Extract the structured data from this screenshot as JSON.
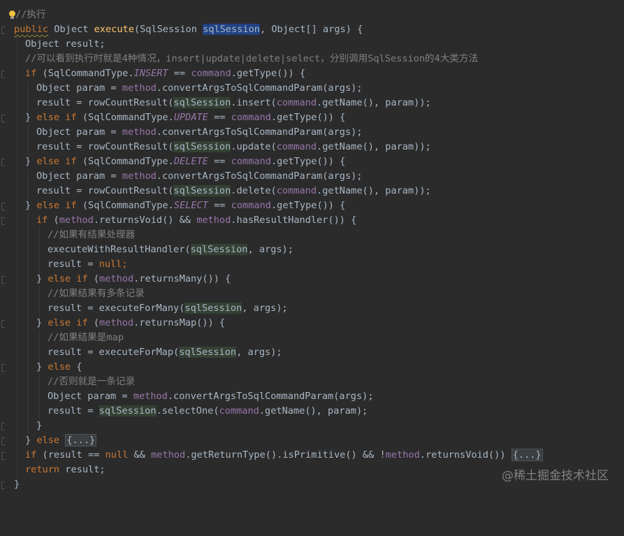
{
  "code": {
    "l0_comment": "//执行",
    "l1_public": "public",
    "l1_type": " Object ",
    "l1_method": "execute",
    "l1_open": "(SqlSession ",
    "l1_param": "sqlSession",
    "l1_rest": ", Object[] args) {",
    "l2": "Object result;",
    "l3_comment": "//可以看到执行时就是4种情况，insert|update|delete|select，分别调用SqlSession的4大类方法",
    "l4_if": "if",
    "l4_a": " (SqlCommandType.",
    "l4_const": "INSERT",
    "l4_b": " == ",
    "l4_cmd": "command",
    "l4_c": ".getType()) {",
    "l5_a": "Object param = ",
    "l5_method": "method",
    "l5_b": ".convertArgsToSqlCommandParam(args);",
    "l6_a": "result = rowCountResult(",
    "l6_sess": "sqlSession",
    "l6_b": ".insert(",
    "l6_cmd": "command",
    "l6_c": ".getName(), param));",
    "l7_a": "} ",
    "l7_kw": "else if",
    "l7_b": " (SqlCommandType.",
    "l7_const": "UPDATE",
    "l7_c": " == ",
    "l7_cmd": "command",
    "l7_d": ".getType()) {",
    "l8_a": "Object param = ",
    "l8_method": "method",
    "l8_b": ".convertArgsToSqlCommandParam(args);",
    "l9_a": "result = rowCountResult(",
    "l9_sess": "sqlSession",
    "l9_b": ".update(",
    "l9_cmd": "command",
    "l9_c": ".getName(), param));",
    "l10_a": "} ",
    "l10_kw": "else if",
    "l10_b": " (SqlCommandType.",
    "l10_const": "DELETE",
    "l10_c": " == ",
    "l10_cmd": "command",
    "l10_d": ".getType()) {",
    "l11_a": "Object param = ",
    "l11_method": "method",
    "l11_b": ".convertArgsToSqlCommandParam(args);",
    "l12_a": "result = rowCountResult(",
    "l12_sess": "sqlSession",
    "l12_b": ".delete(",
    "l12_cmd": "command",
    "l12_c": ".getName(), param));",
    "l13_a": "} ",
    "l13_kw": "else if",
    "l13_b": " (SqlCommandType.",
    "l13_const": "SELECT",
    "l13_c": " == ",
    "l13_cmd": "command",
    "l13_d": ".getType()) {",
    "l14_if": "if",
    "l14_a": " (",
    "l14_m1": "method",
    "l14_b": ".returnsVoid() && ",
    "l14_m2": "method",
    "l14_c": ".hasResultHandler()) {",
    "l15_comment": "//如果有结果处理器",
    "l16_a": "executeWithResultHandler(",
    "l16_sess": "sqlSession",
    "l16_b": ", args);",
    "l17_a": "result = ",
    "l17_null": "null",
    "l17_b": ";",
    "l18_a": "} ",
    "l18_kw": "else if",
    "l18_b": " (",
    "l18_m": "method",
    "l18_c": ".returnsMany()) {",
    "l19_comment": "//如果结果有多条记录",
    "l20_a": "result = executeForMany(",
    "l20_sess": "sqlSession",
    "l20_b": ", args);",
    "l21_a": "} ",
    "l21_kw": "else if",
    "l21_b": " (",
    "l21_m": "method",
    "l21_c": ".returnsMap()) {",
    "l22_comment": "//如果结果是map",
    "l23_a": "result = executeForMap(",
    "l23_sess": "sqlSession",
    "l23_b": ", args);",
    "l24_a": "} ",
    "l24_kw": "else",
    "l24_b": " {",
    "l25_comment": "//否则就是一条记录",
    "l26_a": "Object param = ",
    "l26_method": "method",
    "l26_b": ".convertArgsToSqlCommandParam(args);",
    "l27_a": "result = ",
    "l27_sess": "sqlSession",
    "l27_b": ".selectOne(",
    "l27_cmd": "command",
    "l27_c": ".getName(), param);",
    "l28": "}",
    "l29_a": "} ",
    "l29_kw": "else",
    "l29_b": " ",
    "l29_fold": "{...}",
    "l30_if": "if",
    "l30_a": " (result == ",
    "l30_null": "null",
    "l30_b": " && ",
    "l30_m1": "method",
    "l30_c": ".getReturnType().isPrimitive() && !",
    "l30_m2": "method",
    "l30_d": ".returnsVoid()) ",
    "l30_fold": "{...}",
    "l31_kw": "return",
    "l31_b": " result;",
    "l32": "}"
  },
  "watermark": "@稀土掘金技术社区",
  "colors": {
    "background": "#2b2b2b",
    "keyword": "#cc7832",
    "comment": "#808080",
    "method_decl": "#ffc66d",
    "field": "#9876aa",
    "default_text": "#a9b7c6",
    "selection": "#214283",
    "read_highlight": "#344134"
  },
  "icons": [
    "lightbulb-icon",
    "fold-marker-icon"
  ]
}
